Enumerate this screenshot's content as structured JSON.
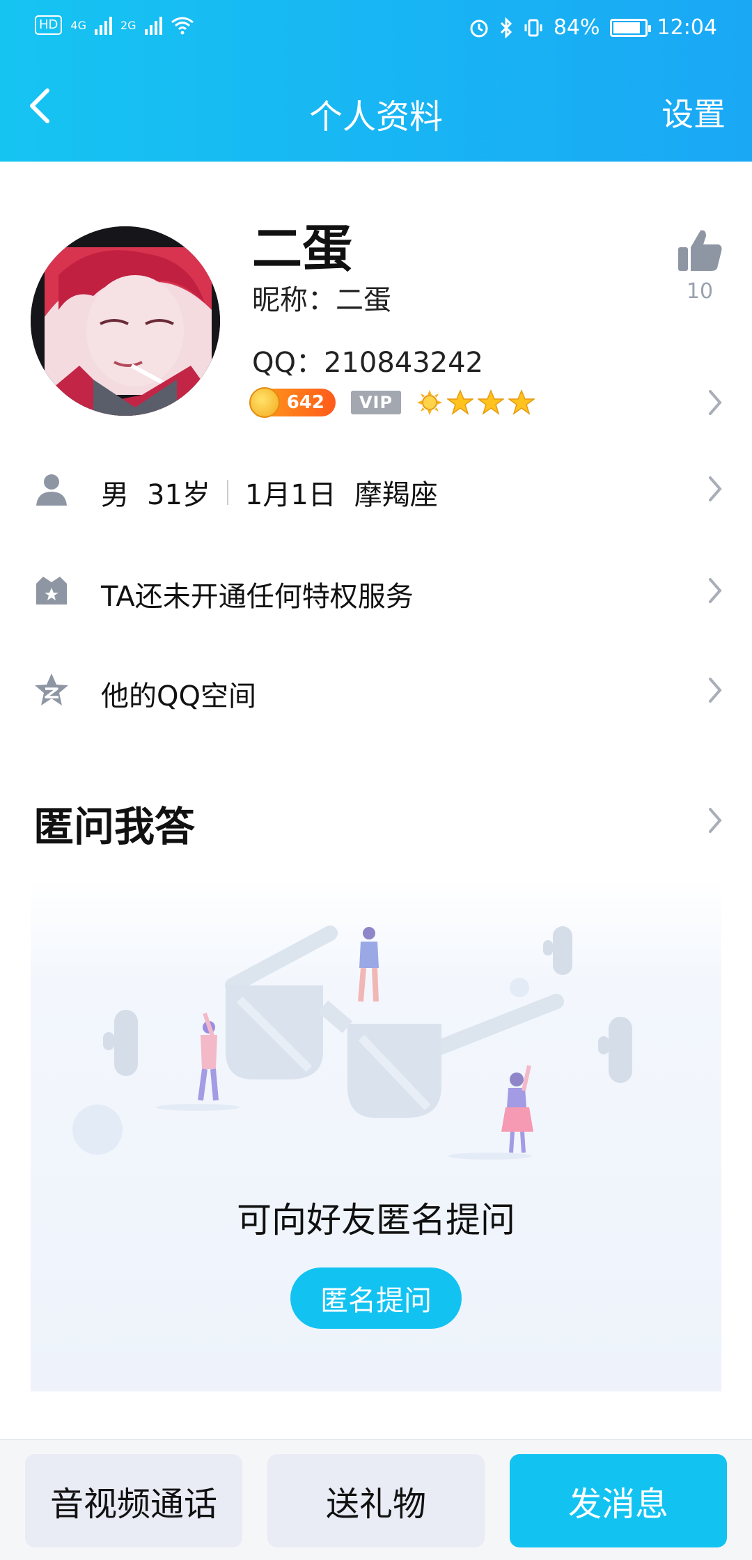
{
  "status_bar": {
    "left_labels": [
      "HD",
      "4G",
      "2G"
    ],
    "battery": "84%",
    "time": "12:04"
  },
  "header": {
    "title": "个人资料",
    "settings_label": "设置",
    "back_icon": "chevron-left-icon"
  },
  "profile": {
    "name": "二蛋",
    "nickname_line": "昵称：二蛋",
    "qq_line": "QQ：210843242",
    "like_count": "10",
    "coin_value": "642",
    "vip_label": "VIP"
  },
  "info_rows": {
    "basic": {
      "gender": "男",
      "age": "31岁",
      "birthday": "1月1日",
      "zodiac": "摩羯座"
    },
    "privilege": "TA还未开通任何特权服务",
    "qzone": "他的QQ空间"
  },
  "qa_section": {
    "title": "匿问我答",
    "prompt": "可向好友匿名提问",
    "button_label": "匿名提问"
  },
  "bottom_bar": {
    "call_label": "音视频通话",
    "gift_label": "送礼物",
    "message_label": "发消息"
  },
  "colors": {
    "accent": "#12c3f2",
    "header_start": "#16c4f2",
    "header_end": "#1aa8f5",
    "icon_gray": "#8f96a3",
    "coin_orange": "#ff6a1a",
    "vip_gray": "#a2a7b0"
  }
}
